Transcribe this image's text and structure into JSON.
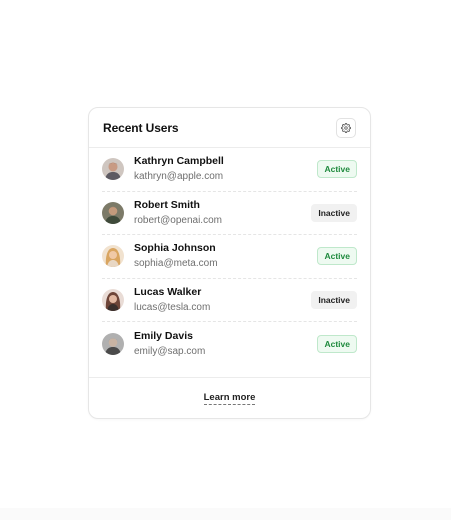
{
  "card": {
    "title": "Recent Users",
    "settings_icon": "gear-icon"
  },
  "users": [
    {
      "name": "Kathryn Campbell",
      "email": "kathryn@apple.com",
      "status": "Active",
      "avatar_color": "#b98f7a"
    },
    {
      "name": "Robert Smith",
      "email": "robert@openai.com",
      "status": "Inactive",
      "avatar_color": "#6b6a55"
    },
    {
      "name": "Sophia Johnson",
      "email": "sophia@meta.com",
      "status": "Active",
      "avatar_color": "#d9a560"
    },
    {
      "name": "Lucas Walker",
      "email": "lucas@tesla.com",
      "status": "Inactive",
      "avatar_color": "#8a6458"
    },
    {
      "name": "Emily Davis",
      "email": "emily@sap.com",
      "status": "Active",
      "avatar_color": "#8c8c8c"
    }
  ],
  "footer": {
    "link_label": "Learn more"
  },
  "colors": {
    "active_text": "#1e8a3d",
    "active_bg": "#eefaf1",
    "inactive_bg": "#f1f1f1"
  }
}
